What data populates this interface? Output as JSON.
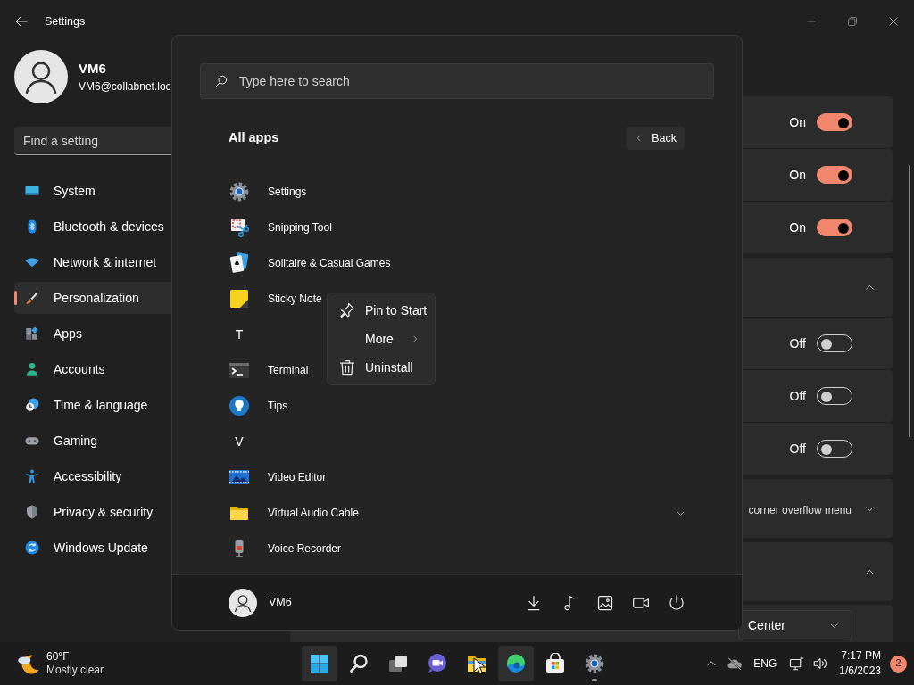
{
  "window": {
    "title": "Settings"
  },
  "profile": {
    "name": "VM6",
    "email": "VM6@collabnet.loc"
  },
  "settings_search": {
    "placeholder": "Find a setting"
  },
  "nav": [
    {
      "label": "System",
      "selected": false
    },
    {
      "label": "Bluetooth & devices",
      "selected": false
    },
    {
      "label": "Network & internet",
      "selected": false
    },
    {
      "label": "Personalization",
      "selected": true
    },
    {
      "label": "Apps",
      "selected": false
    },
    {
      "label": "Accounts",
      "selected": false
    },
    {
      "label": "Time & language",
      "selected": false
    },
    {
      "label": "Gaming",
      "selected": false
    },
    {
      "label": "Accessibility",
      "selected": false
    },
    {
      "label": "Privacy & security",
      "selected": false
    },
    {
      "label": "Windows Update",
      "selected": false
    }
  ],
  "content_rows": [
    {
      "kind": "toggle",
      "state_text": "On",
      "on": true
    },
    {
      "kind": "toggle",
      "state_text": "On",
      "on": true
    },
    {
      "kind": "toggle",
      "state_text": "On",
      "on": true
    },
    {
      "kind": "group",
      "expanded": true
    },
    {
      "kind": "toggle",
      "state_text": "Off",
      "on": false
    },
    {
      "kind": "toggle",
      "state_text": "Off",
      "on": false
    },
    {
      "kind": "toggle",
      "state_text": "Off",
      "on": false
    },
    {
      "kind": "group",
      "expanded": false,
      "text": "corner overflow menu"
    },
    {
      "kind": "group",
      "expanded": true
    },
    {
      "kind": "dropdown",
      "value": "Center"
    }
  ],
  "start_menu": {
    "search_placeholder": "Type here to search",
    "heading": "All apps",
    "back": "Back",
    "apps": [
      {
        "kind": "app",
        "label": "Settings"
      },
      {
        "kind": "app",
        "label": "Snipping Tool"
      },
      {
        "kind": "app",
        "label": "Solitaire & Casual Games"
      },
      {
        "kind": "app",
        "label": "Sticky Note"
      },
      {
        "kind": "letter",
        "label": "T"
      },
      {
        "kind": "app",
        "label": "Terminal"
      },
      {
        "kind": "app",
        "label": "Tips"
      },
      {
        "kind": "letter",
        "label": "V"
      },
      {
        "kind": "app",
        "label": "Video Editor"
      },
      {
        "kind": "app",
        "label": "Virtual Audio Cable",
        "expanded": false
      },
      {
        "kind": "app",
        "label": "Voice Recorder"
      }
    ],
    "user": "VM6"
  },
  "context_menu": [
    {
      "label": "Pin to Start",
      "submenu": false
    },
    {
      "label": "More",
      "submenu": true
    },
    {
      "label": "Uninstall",
      "submenu": false
    }
  ],
  "taskbar": {
    "weather": {
      "temperature": "60°F",
      "condition": "Mostly clear"
    },
    "apps": [
      {
        "highlighted": true,
        "running": false
      },
      {
        "highlighted": false,
        "running": false
      },
      {
        "highlighted": false,
        "running": false
      },
      {
        "highlighted": false,
        "running": false
      },
      {
        "highlighted": false,
        "running": false
      },
      {
        "highlighted": true,
        "running": false
      },
      {
        "highlighted": false,
        "running": false
      },
      {
        "highlighted": false,
        "running": true
      }
    ],
    "language": "ENG",
    "time": "7:17 PM",
    "date": "1/6/2023",
    "notifications": "2"
  }
}
